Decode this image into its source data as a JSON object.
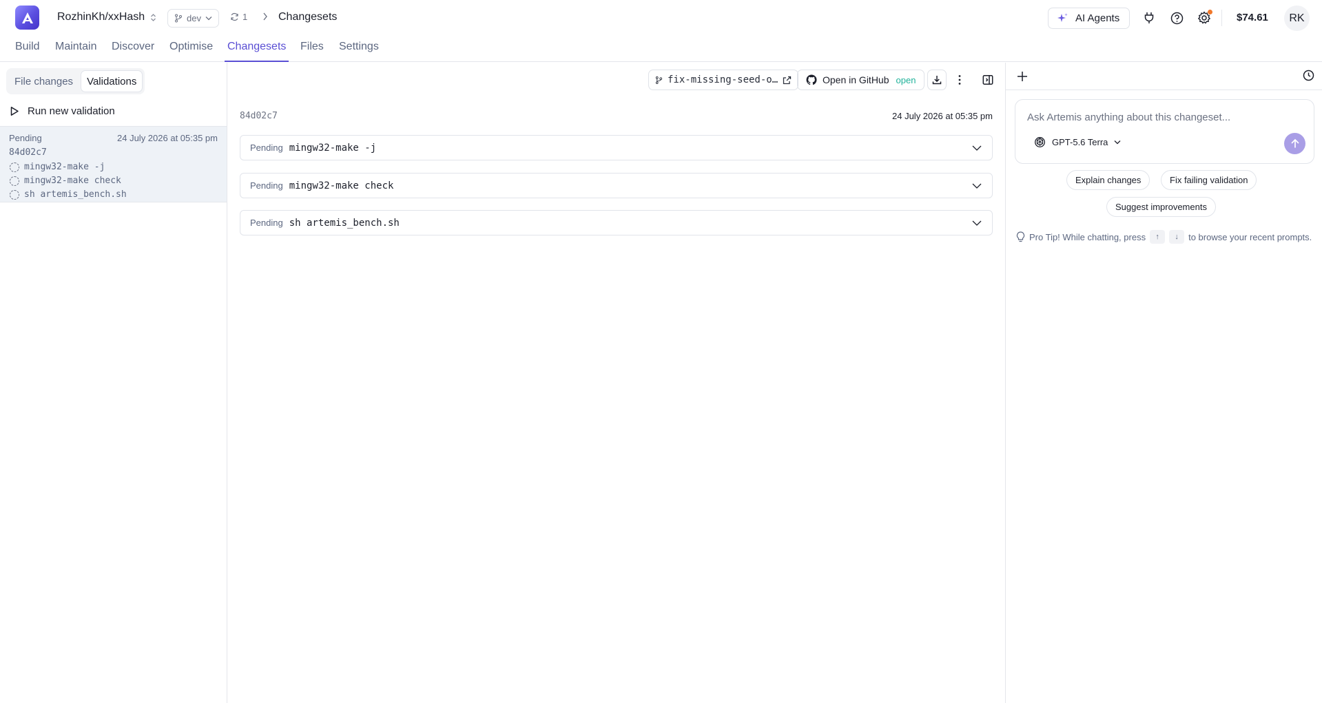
{
  "header": {
    "repo": "RozhinKh/xxHash",
    "branch": "dev",
    "sync_count": "1",
    "breadcrumb": "Changesets",
    "ai_agents_label": "AI Agents",
    "balance": "$74.61",
    "avatar_initials": "RK"
  },
  "nav": {
    "tabs": [
      "Build",
      "Maintain",
      "Discover",
      "Optimise",
      "Changesets",
      "Files",
      "Settings"
    ],
    "active": "Changesets"
  },
  "left": {
    "segments": [
      "File changes",
      "Validations"
    ],
    "active_segment": "Validations",
    "run_label": "Run new validation",
    "validation": {
      "status": "Pending",
      "date": "24 July 2026 at 05:35 pm",
      "hash": "84d02c7",
      "commands": [
        "mingw32-make -j",
        "mingw32-make check",
        "sh artemis_bench.sh"
      ]
    }
  },
  "middle": {
    "branch_label": "fix-missing-seed-o…",
    "github_label": "Open in GitHub",
    "github_status": "open",
    "hash": "84d02c7",
    "date": "24 July 2026 at 05:35 pm",
    "rows": [
      {
        "status": "Pending",
        "command": "mingw32-make -j"
      },
      {
        "status": "Pending",
        "command": "mingw32-make check"
      },
      {
        "status": "Pending",
        "command": "sh artemis_bench.sh"
      }
    ]
  },
  "right": {
    "placeholder": "Ask Artemis anything about this changeset...",
    "model": "GPT-5.6 Terra",
    "chips": [
      "Explain changes",
      "Fix failing validation",
      "Suggest improvements"
    ],
    "tip_prefix": "Pro Tip! While chatting, press",
    "tip_up": "↑",
    "tip_down": "↓",
    "tip_suffix": "to browse your recent prompts."
  },
  "colors": {
    "accent": "#5a4fd4",
    "open_status": "#1fb29a",
    "notification": "#f0782b",
    "send_button": "#a99ee6"
  }
}
